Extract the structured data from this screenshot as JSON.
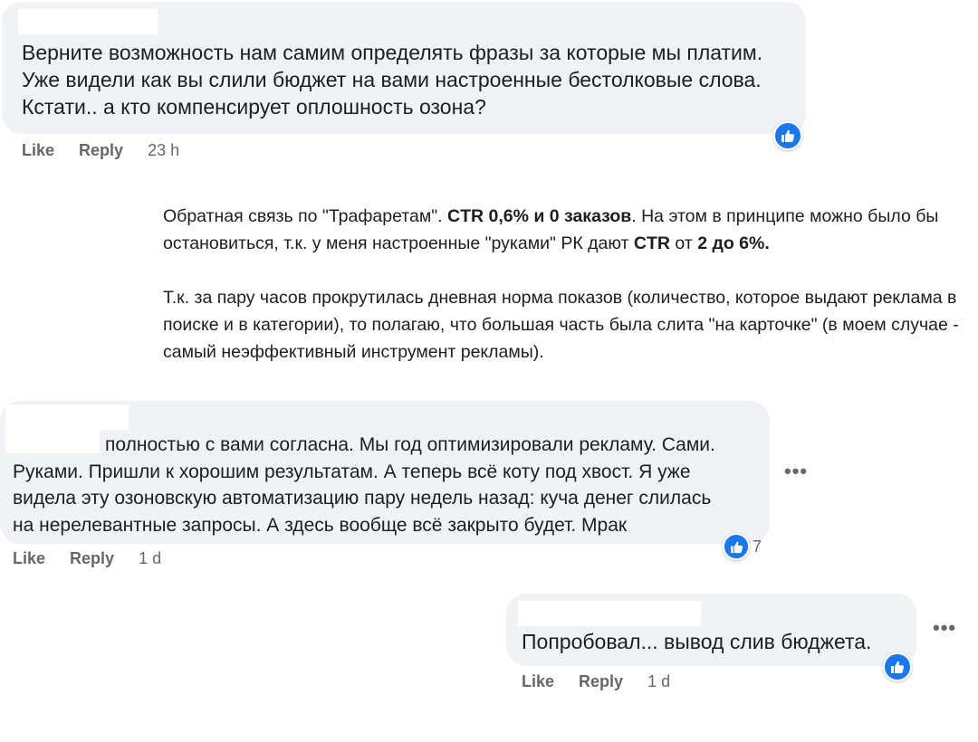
{
  "comments": [
    {
      "text_lines": [
        "Верните возможность нам самим определять фразы за которые мы платим.",
        "Уже видели как вы слили бюджет на вами настроенные бестолковые слова.",
        "Кстати.. а кто компенсирует оплошность озона?"
      ],
      "like_label": "Like",
      "reply_label": "Reply",
      "time": "23 h",
      "reaction_icon": "thumbs-up-icon"
    },
    {
      "text_lines": [
        "полностью с вами согласна. Мы год оптимизировали рекламу. Сами.",
        "Руками. Пришли к хорошим результатам. А теперь всё коту под хвост. Я уже",
        "видела эту озоновскую автоматизацию пару недель назад: куча денег слилась",
        "на нерелевантные запросы. А здесь вообще всё закрыто будет. Мрак"
      ],
      "like_label": "Like",
      "reply_label": "Reply",
      "time": "1 d",
      "reaction_icon": "thumbs-up-icon",
      "reaction_count": "7",
      "more_label": "•••"
    },
    {
      "text_lines": [
        "Попробовал... вывод слив бюджета."
      ],
      "like_label": "Like",
      "reply_label": "Reply",
      "time": "1 d",
      "reaction_icon": "thumbs-up-icon",
      "more_label": "•••"
    }
  ],
  "note": {
    "p1": {
      "t1": "Обратная связь по \"Трафаретам\". ",
      "b1": "CTR 0,6% и 0 заказов",
      "t2": ". На этом в принципе можно было бы остановиться, т.к. у меня настроенные \"руками\" РК дают ",
      "b2": "CTR",
      "t3": " от ",
      "b3": "2 до 6%."
    },
    "p2": "Т.к. за пару часов прокрутилась дневная норма показов (количество, которое выдают реклама в поиске и в категории), то полагаю, что большая часть была слита \"на карточке\" (в моем случае - самый неэффективный инструмент рекламы)."
  },
  "colors": {
    "bubble_bg": "#f0f2f5",
    "like_blue": "#1877f2",
    "meta_gray": "#65676b",
    "text": "#1c1e21"
  }
}
